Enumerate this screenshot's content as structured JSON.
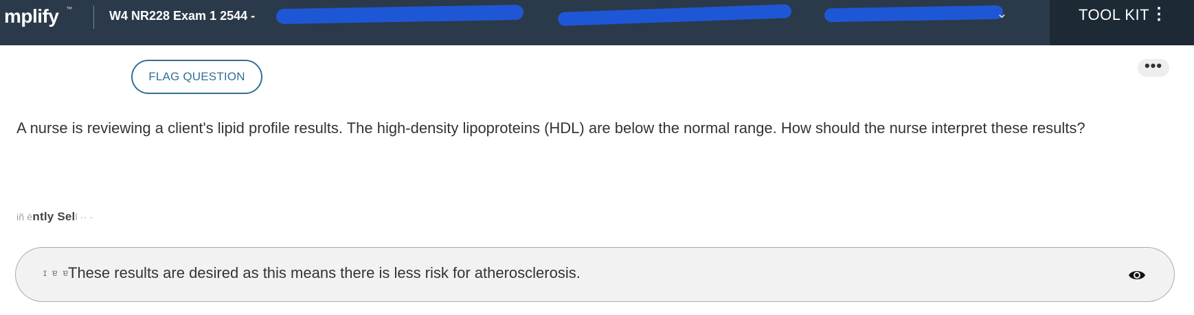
{
  "header": {
    "brand": "mplify",
    "brand_tm": "™",
    "exam_title": "W4 NR228 Exam 1 2544 -",
    "toolkit_label": "TOOL KIT",
    "toolkit_dots": "⋮",
    "chevron": "⌄",
    "redaction_color": "#1e57d6",
    "bar_color": "#2b3a4a"
  },
  "actions": {
    "flag_label": "FLAG QUESTION",
    "more_label": "•••"
  },
  "question": {
    "text": "A nurse is reviewing a client's lipid profile results. The high-density lipoproteins (HDL) are below the normal range. How should the nurse interpret these results?"
  },
  "instruction": {
    "text": "ntly Sel",
    "prefix_noise": "iñ ë",
    "suffix_noise": "l ·· ·"
  },
  "options": [
    {
      "letter": "ɪ ɐ ɐ",
      "text": "These results are desired as this means there is less risk for atherosclerosis.",
      "icon": "eye-icon"
    }
  ]
}
